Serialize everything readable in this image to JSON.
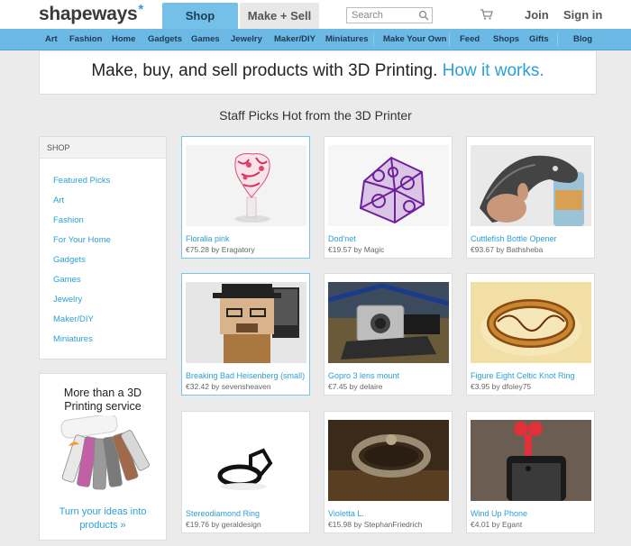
{
  "header": {
    "logo_text": "shapeways",
    "logo_star": "*",
    "tabs": [
      {
        "label": "Shop",
        "active": true
      },
      {
        "label": "Make + Sell",
        "active": false
      }
    ],
    "search_placeholder": "Search",
    "join_label": "Join",
    "signin_label": "Sign in"
  },
  "nav": {
    "items": [
      "Art",
      "Fashion",
      "Home",
      "Gadgets",
      "Games",
      "Jewelry",
      "Maker/DIY",
      "Miniatures",
      "Make Your Own",
      "Feed",
      "Shops",
      "Gifts",
      "Blog"
    ]
  },
  "banner": {
    "text": "Make, buy, and sell products with 3D Printing.",
    "link": "How it works."
  },
  "section_title": "Staff Picks Hot from the 3D Printer",
  "sidebar": {
    "heading": "SHOP",
    "links": [
      "Featured Picks",
      "Art",
      "Fashion",
      "For Your Home",
      "Gadgets",
      "Games",
      "Jewelry",
      "Maker/DIY",
      "Miniatures"
    ]
  },
  "promo": {
    "title_line1": "More than a 3D",
    "title_line2": "Printing service",
    "link_line1": "Turn your ideas into",
    "link_line2": "products »"
  },
  "products": [
    {
      "title": "Floralia pink",
      "price": "€75.28",
      "by": "by",
      "author": "Eragatory"
    },
    {
      "title": "Dod'net",
      "price": "€19.57",
      "by": "by",
      "author": "Magic"
    },
    {
      "title": "Cuttlefish Bottle Opener",
      "price": "€93.67",
      "by": "by",
      "author": "Bathsheba"
    },
    {
      "title": "Breaking Bad Heisenberg (small)",
      "price": "€32.42",
      "by": "by",
      "author": "sevensheaven"
    },
    {
      "title": "Gopro 3 lens mount",
      "price": "€7.45",
      "by": "by",
      "author": "delaire"
    },
    {
      "title": "Figure Eight Celtic Knot Ring",
      "price": "€3.95",
      "by": "by",
      "author": "dfoley75"
    },
    {
      "title": "Stereodiamond Ring",
      "price": "€19.76",
      "by": "by",
      "author": "geraldesign"
    },
    {
      "title": "Violetta L.",
      "price": "€15.98",
      "by": "by",
      "author": "StephanFriedrich"
    },
    {
      "title": "Wind Up Phone",
      "price": "€4.01",
      "by": "by",
      "author": "Egant"
    }
  ],
  "colors": {
    "accent_blue": "#2b9fd9",
    "nav_blue": "#6bb9e4",
    "shop_tab": "#74c0e8"
  }
}
